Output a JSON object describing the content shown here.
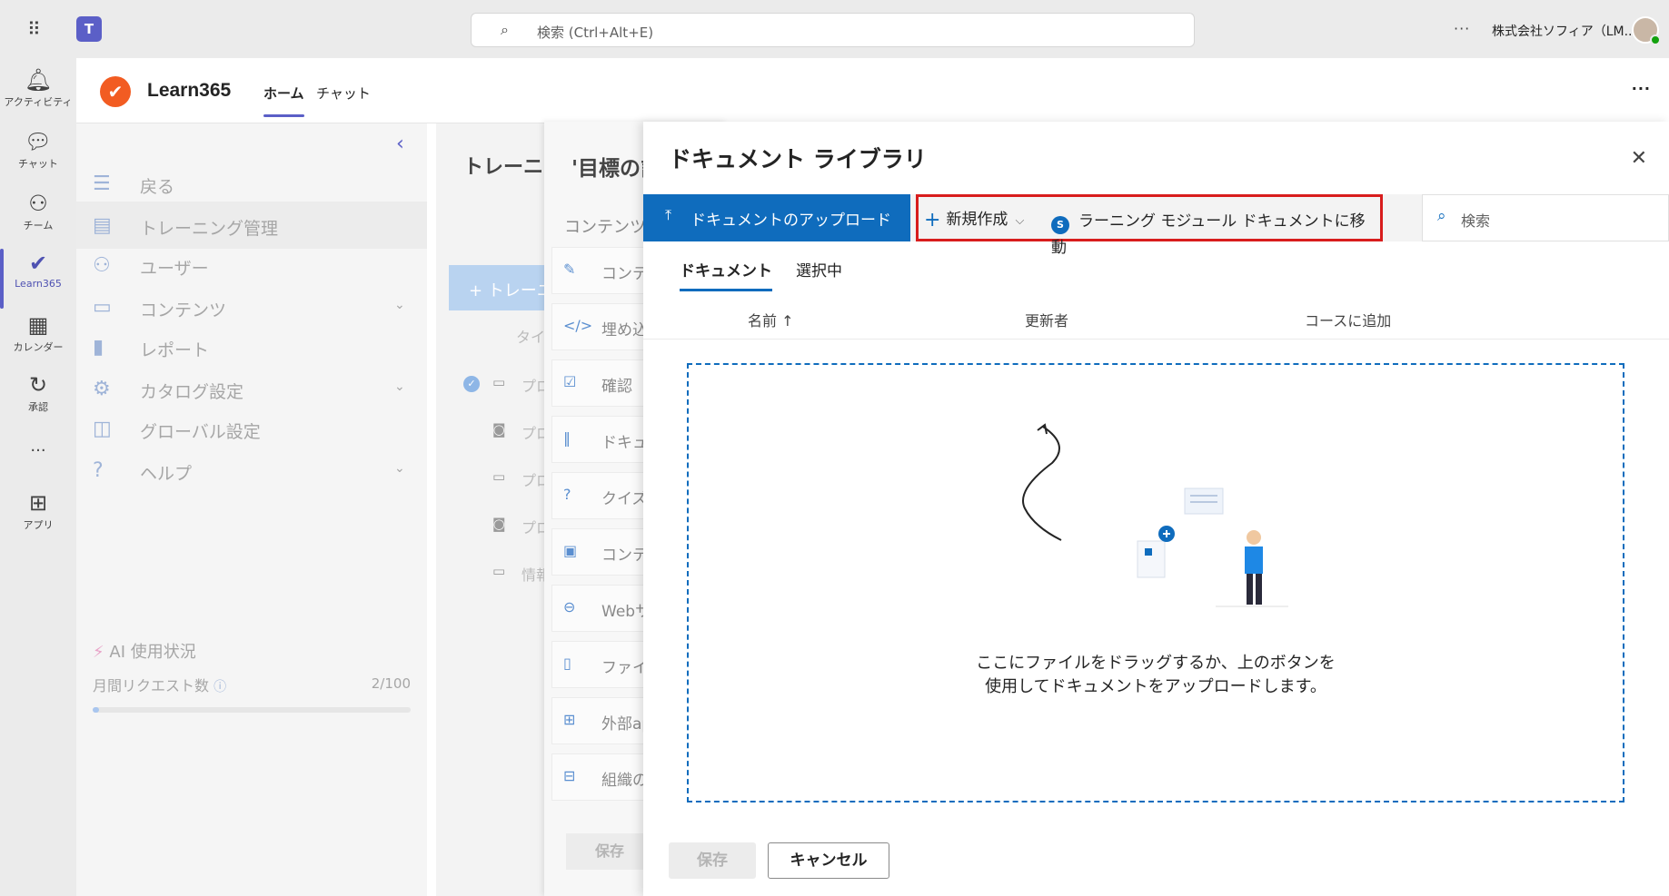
{
  "topbar": {
    "search_placeholder": "検索 (Ctrl+Alt+E)",
    "more_label": "···",
    "org_name": "株式会社ソフィア（LM..."
  },
  "appbar": {
    "items": [
      {
        "label": "アクティビティ",
        "icon": "bell-icon"
      },
      {
        "label": "チャット",
        "icon": "chat-icon"
      },
      {
        "label": "チーム",
        "icon": "teams-icon"
      },
      {
        "label": "Learn365",
        "icon": "learn365-icon"
      },
      {
        "label": "カレンダー",
        "icon": "calendar-icon"
      },
      {
        "label": "承認",
        "icon": "approvals-icon"
      },
      {
        "label": "···",
        "icon": "more-icon"
      },
      {
        "label": "アプリ",
        "icon": "apps-icon"
      }
    ]
  },
  "app": {
    "name": "Learn365",
    "tabs": [
      "ホーム",
      "チャット"
    ],
    "more_label": "···"
  },
  "leftnav": {
    "items": [
      {
        "label": "戻る",
        "icon": "back-list-icon"
      },
      {
        "label": "トレーニング管理",
        "icon": "training-icon"
      },
      {
        "label": "ユーザー",
        "icon": "users-icon"
      },
      {
        "label": "コンテンツ",
        "icon": "folder-icon"
      },
      {
        "label": "レポート",
        "icon": "report-icon"
      },
      {
        "label": "カタログ設定",
        "icon": "gear-icon"
      },
      {
        "label": "グローバル設定",
        "icon": "global-settings-icon"
      },
      {
        "label": "ヘルプ",
        "icon": "help-icon"
      }
    ],
    "ai_usage_label": "AI 使用状況",
    "monthly_requests_label": "月間リクエスト数",
    "monthly_requests_value": "2/100",
    "monthly_requests_fraction": 0.02
  },
  "training_panel": {
    "title": "トレーニ",
    "add_button": "+ トレーニ",
    "col_header": "タイ",
    "rows": [
      "プロ",
      "プロ",
      "プロ",
      "プロ",
      "情報"
    ]
  },
  "goal_panel": {
    "title": "'目標の計",
    "subtitle": "コンテンツ",
    "rows": [
      {
        "label": "コンテ",
        "icon": "content-icon"
      },
      {
        "label": "埋め込",
        "icon": "embed-icon"
      },
      {
        "label": "確認",
        "icon": "checklist-icon"
      },
      {
        "label": "ドキュ",
        "icon": "library-icon"
      },
      {
        "label": "クイズ",
        "icon": "quiz-icon"
      },
      {
        "label": "コンテ",
        "icon": "content-package-icon"
      },
      {
        "label": "Webサ",
        "icon": "web-icon"
      },
      {
        "label": "ファイ",
        "icon": "file-icon"
      },
      {
        "label": "外部ap",
        "icon": "external-app-icon"
      },
      {
        "label": "組織の",
        "icon": "org-icon"
      }
    ],
    "save_label": "保存"
  },
  "dialog": {
    "title": "ドキュメント ライブラリ",
    "upload_label": "ドキュメントのアップロード",
    "new_label": "新規作成",
    "move_label": "ラーニング モジュール ドキュメントに移動",
    "search_placeholder": "検索",
    "tabs": [
      "ドキュメント",
      "選択中"
    ],
    "columns": [
      "名前 ↑",
      "更新者",
      "コースに追加"
    ],
    "empty_message": "ここにファイルをドラッグするか、上のボタンを使用してドキュメントをアップロードします。",
    "save_label": "保存",
    "cancel_label": "キャンセル"
  },
  "colors": {
    "teams_purple": "#5b5fc7",
    "primary_blue": "#0f6cbd",
    "highlight_red": "#d81d1d",
    "learn365_orange": "#f25c22"
  }
}
